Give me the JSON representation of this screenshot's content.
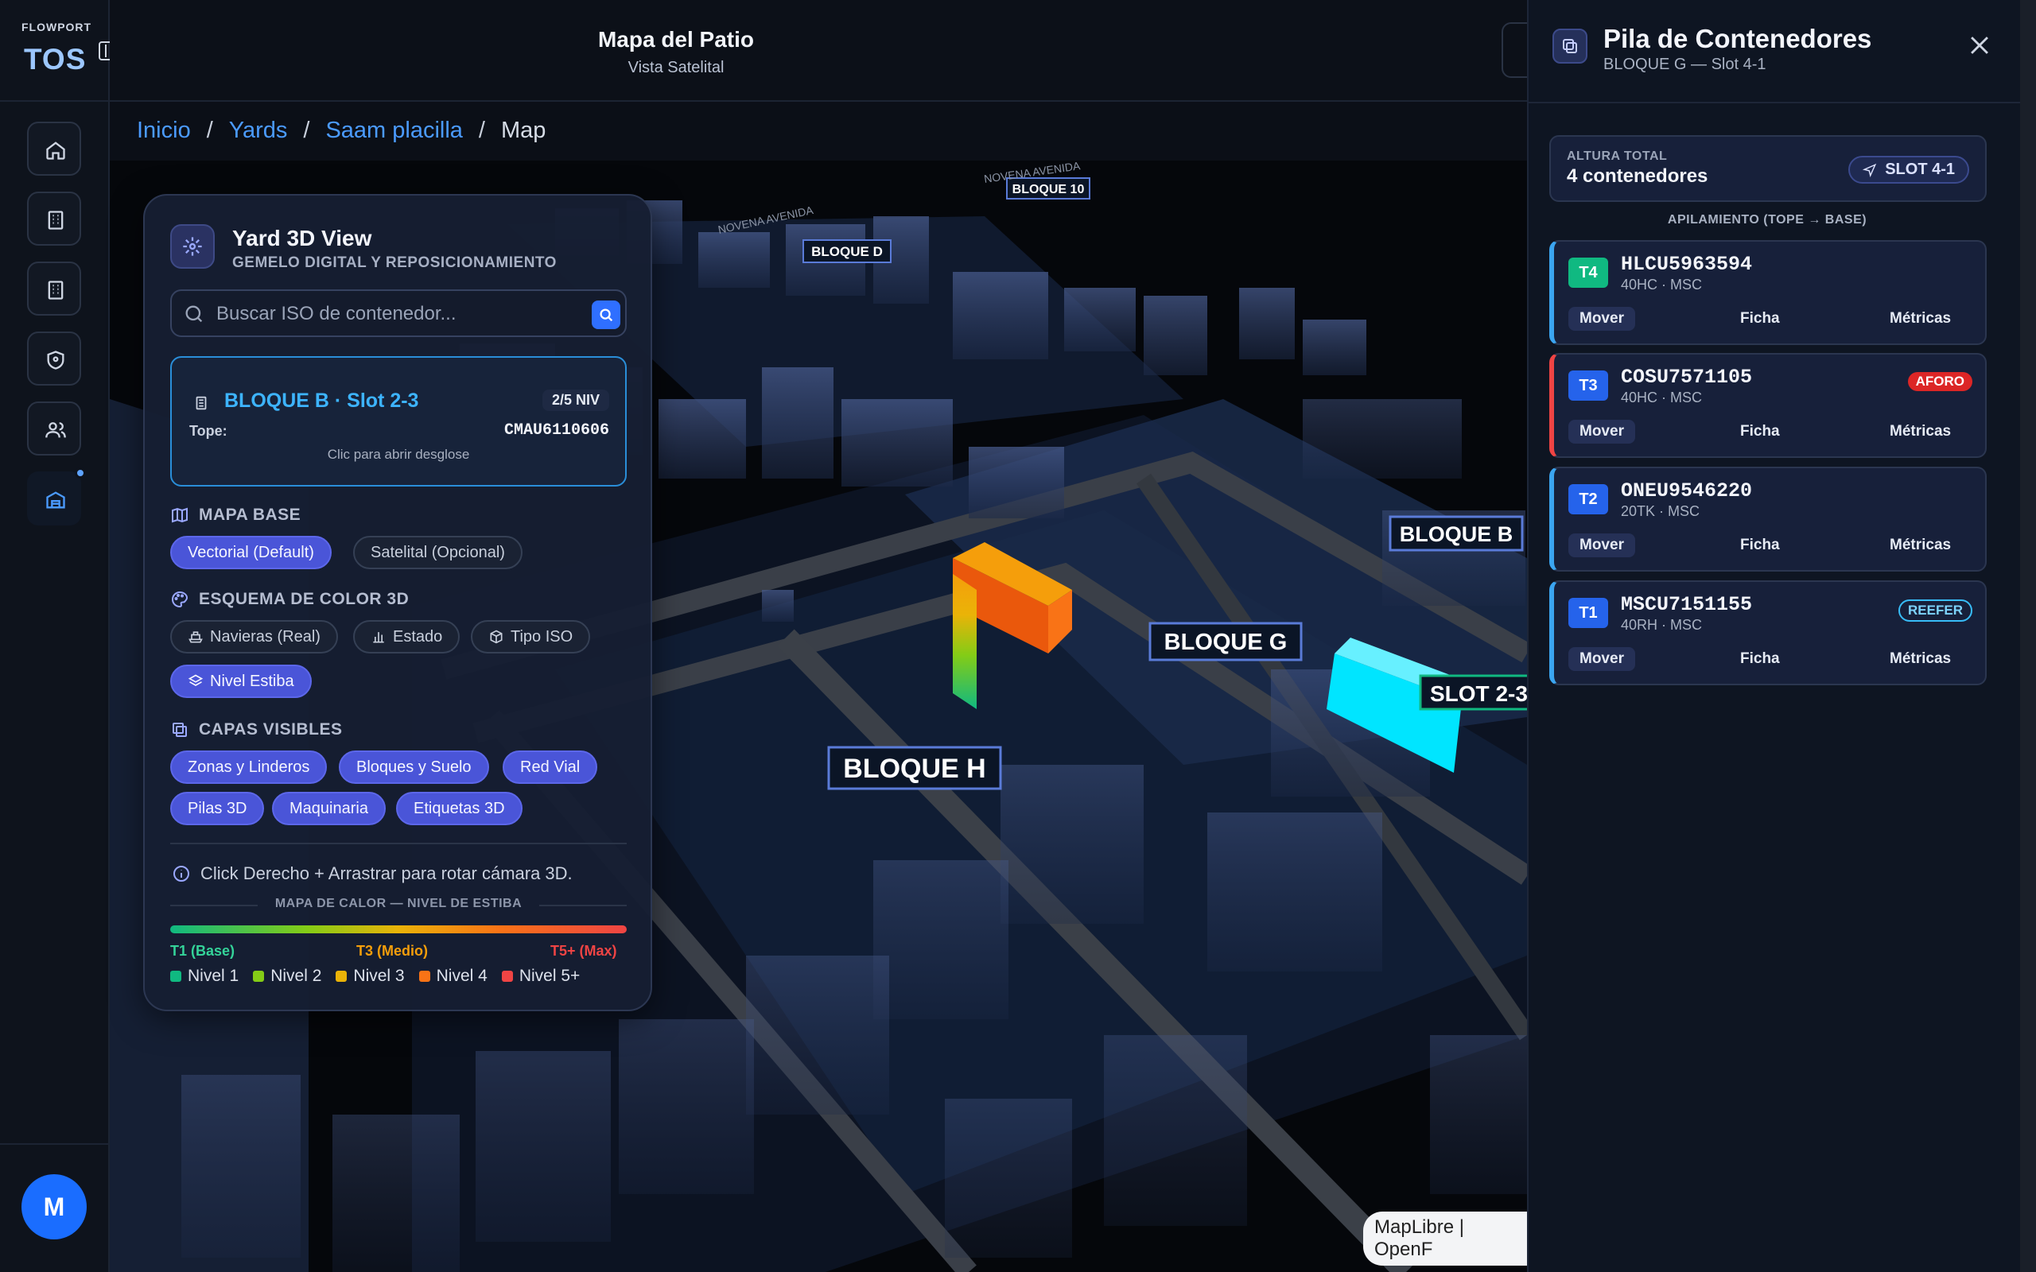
{
  "brand": {
    "top": "FLOWPORT",
    "main": "TOS"
  },
  "avatar": {
    "initial": "M"
  },
  "header": {
    "title": "Mapa del Patio",
    "subtitle": "Vista Satelital"
  },
  "breadcrumb": {
    "items": [
      "Inicio",
      "Yards",
      "Saam placilla"
    ],
    "current": "Map"
  },
  "map": {
    "labels": {
      "bloque_10": "BLOQUE 10",
      "bloque_d": "BLOQUE D",
      "bloque_b": "BLOQUE B",
      "bloque_g": "BLOQUE G",
      "bloque_h": "BLOQUE H",
      "slot": "SLOT 2-3",
      "avenida_1": "NOVENA AVENIDA",
      "avenida_2": "NOVENA AVENIDA"
    },
    "attribution": "MapLibre | OpenF"
  },
  "panel": {
    "title": "Yard 3D View",
    "subtitle": "GEMELO DIGITAL Y REPOSICIONAMIENTO",
    "search_placeholder": "Buscar ISO de contenedor...",
    "slot_card": {
      "title": "BLOQUE B · Slot 2-3",
      "badge": "2/5 NIV",
      "tope_label": "Tope:",
      "tope_value": "CMAU6110606",
      "hint": "Clic para abrir desglose"
    },
    "mapa_base": {
      "label": "MAPA BASE",
      "options": [
        "Vectorial (Default)",
        "Satelital (Opcional)"
      ]
    },
    "esquema": {
      "label": "ESQUEMA DE COLOR 3D",
      "options": [
        "Navieras (Real)",
        "Estado",
        "Tipo ISO",
        "Nivel Estiba"
      ]
    },
    "capas": {
      "label": "CAPAS VISIBLES",
      "options": [
        "Zonas y Linderos",
        "Bloques y Suelo",
        "Red Vial",
        "Pilas 3D",
        "Maquinaria",
        "Etiquetas 3D"
      ]
    },
    "hint": "Click Derecho + Arrastrar para rotar cámara 3D.",
    "heatmap": {
      "label": "MAPA DE CALOR — NIVEL DE ESTIBA",
      "t1": "T1 (Base)",
      "t3": "T3 (Medio)",
      "t5": "T5+ (Max)"
    },
    "legend": [
      {
        "label": "Nivel 1",
        "color": "#10b981"
      },
      {
        "label": "Nivel 2",
        "color": "#84cc16"
      },
      {
        "label": "Nivel 3",
        "color": "#eab308"
      },
      {
        "label": "Nivel 4",
        "color": "#f97316"
      },
      {
        "label": "Nivel 5+",
        "color": "#ef4444"
      }
    ]
  },
  "stack": {
    "title": "Pila de Contenedores",
    "subtitle": "BLOQUE G — Slot 4-1",
    "height_label": "ALTURA TOTAL",
    "height_value": "4 contenedores",
    "slot_tag": "SLOT 4-1",
    "apilamiento": "APILAMIENTO (TOPE → BASE)",
    "containers": [
      {
        "tier": "T4",
        "tier_color": "#10b981",
        "id": "HLCU5963594",
        "meta": "40HC · MSC",
        "tag": ""
      },
      {
        "tier": "T3",
        "tier_color": "#2563eb",
        "id": "COSU7571105",
        "meta": "40HC · MSC",
        "tag": "AFORO"
      },
      {
        "tier": "T2",
        "tier_color": "#2563eb",
        "id": "ONEU9546220",
        "meta": "20TK · MSC",
        "tag": ""
      },
      {
        "tier": "T1",
        "tier_color": "#2563eb",
        "id": "MSCU7151155",
        "meta": "40RH · MSC",
        "tag": "REEFER"
      }
    ],
    "actions": [
      "Mover",
      "Ficha",
      "Métricas"
    ]
  }
}
